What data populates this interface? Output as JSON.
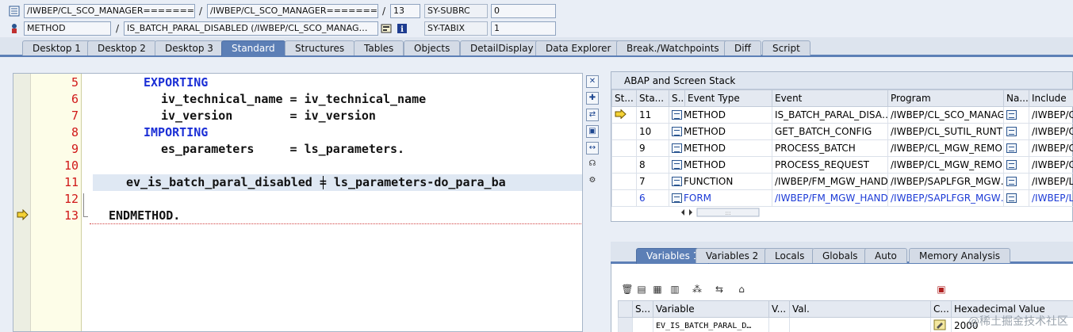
{
  "top": {
    "row1": {
      "field1": "/IWBEP/CL_SCO_MANAGER========",
      "sep1": "/",
      "field2": "/IWBEP/CL_SCO_MANAGER========",
      "sep2": "/",
      "line": "13",
      "sy_name": "SY-SUBRC",
      "sy_value": "0"
    },
    "row2": {
      "type": "METHOD",
      "sep": "/",
      "name": "IS_BATCH_PARAL_DISABLED (/IWBEP/CL_SCO_MANAG…",
      "sy_name": "SY-TABIX",
      "sy_value": "1"
    }
  },
  "tabs": [
    {
      "label": "Desktop 1"
    },
    {
      "label": "Desktop 2"
    },
    {
      "label": "Desktop 3"
    },
    {
      "label": "Standard",
      "active": true
    },
    {
      "label": "Structures"
    },
    {
      "label": "Tables"
    },
    {
      "label": "Objects"
    },
    {
      "label": "DetailDisplay"
    },
    {
      "label": "Data Explorer"
    },
    {
      "label": "Break./Watchpoints"
    },
    {
      "label": "Diff"
    },
    {
      "label": "Script"
    }
  ],
  "editor": {
    "lines": [
      {
        "num": "5",
        "text": "EXPORTING"
      },
      {
        "num": "6",
        "text": "iv_technical_name = iv_technical_name"
      },
      {
        "num": "7",
        "text": "iv_version        = iv_version"
      },
      {
        "num": "8",
        "text": "IMPORTING"
      },
      {
        "num": "9",
        "text": "es_parameters     = ls_parameters."
      },
      {
        "num": "10",
        "text": ""
      },
      {
        "num": "11",
        "text": "ev_is_batch_paral_disabled = ls_parameters-do_para_ba"
      },
      {
        "num": "12",
        "text": ""
      },
      {
        "num": "13",
        "text": "ENDMETHOD."
      }
    ]
  },
  "stack": {
    "title": "ABAP and Screen Stack",
    "columns": [
      "St...",
      "Sta...",
      "S...",
      "Event Type",
      "Event",
      "Program",
      "Na...",
      "Include"
    ],
    "rows": [
      {
        "level": "11",
        "type": "METHOD",
        "event": "IS_BATCH_PARAL_DISA…",
        "program": "/IWBEP/CL_SCO_MANAG…",
        "include": "/IWBEP/CI",
        "current": true
      },
      {
        "level": "10",
        "type": "METHOD",
        "event": "GET_BATCH_CONFIG",
        "program": "/IWBEP/CL_SUTIL_RUNT…",
        "include": "/IWBEP/CI"
      },
      {
        "level": "9",
        "type": "METHOD",
        "event": "PROCESS_BATCH",
        "program": "/IWBEP/CL_MGW_REMO…",
        "include": "/IWBEP/CI"
      },
      {
        "level": "8",
        "type": "METHOD",
        "event": "PROCESS_REQUEST",
        "program": "/IWBEP/CL_MGW_REMO…",
        "include": "/IWBEP/CI"
      },
      {
        "level": "7",
        "type": "FUNCTION",
        "event": "/IWBEP/FM_MGW_HAND…",
        "program": "/IWBEP/SAPLFGR_MGW…",
        "include": "/IWBEP/LF"
      },
      {
        "level": "6",
        "type": "FORM",
        "event": "/IWBEP/FM_MGW_HAND…",
        "program": "/IWBEP/SAPLFGR_MGW…",
        "include": "/IWBEP/LF",
        "blue": true
      }
    ]
  },
  "vartabs": [
    {
      "label": "Variables 1",
      "active": true
    },
    {
      "label": "Variables 2"
    },
    {
      "label": "Locals"
    },
    {
      "label": "Globals"
    },
    {
      "label": "Auto"
    },
    {
      "label": "Memory Analysis"
    }
  ],
  "variables": {
    "columns": [
      "S...",
      "Variable",
      "V...",
      "Val.",
      "C...",
      "Hexadecimal Value"
    ],
    "rows": [
      {
        "variable": "EV_IS_BATCH_PARAL_D…",
        "hex": "2000"
      }
    ]
  },
  "watermark": "@稀土掘金技术社区"
}
